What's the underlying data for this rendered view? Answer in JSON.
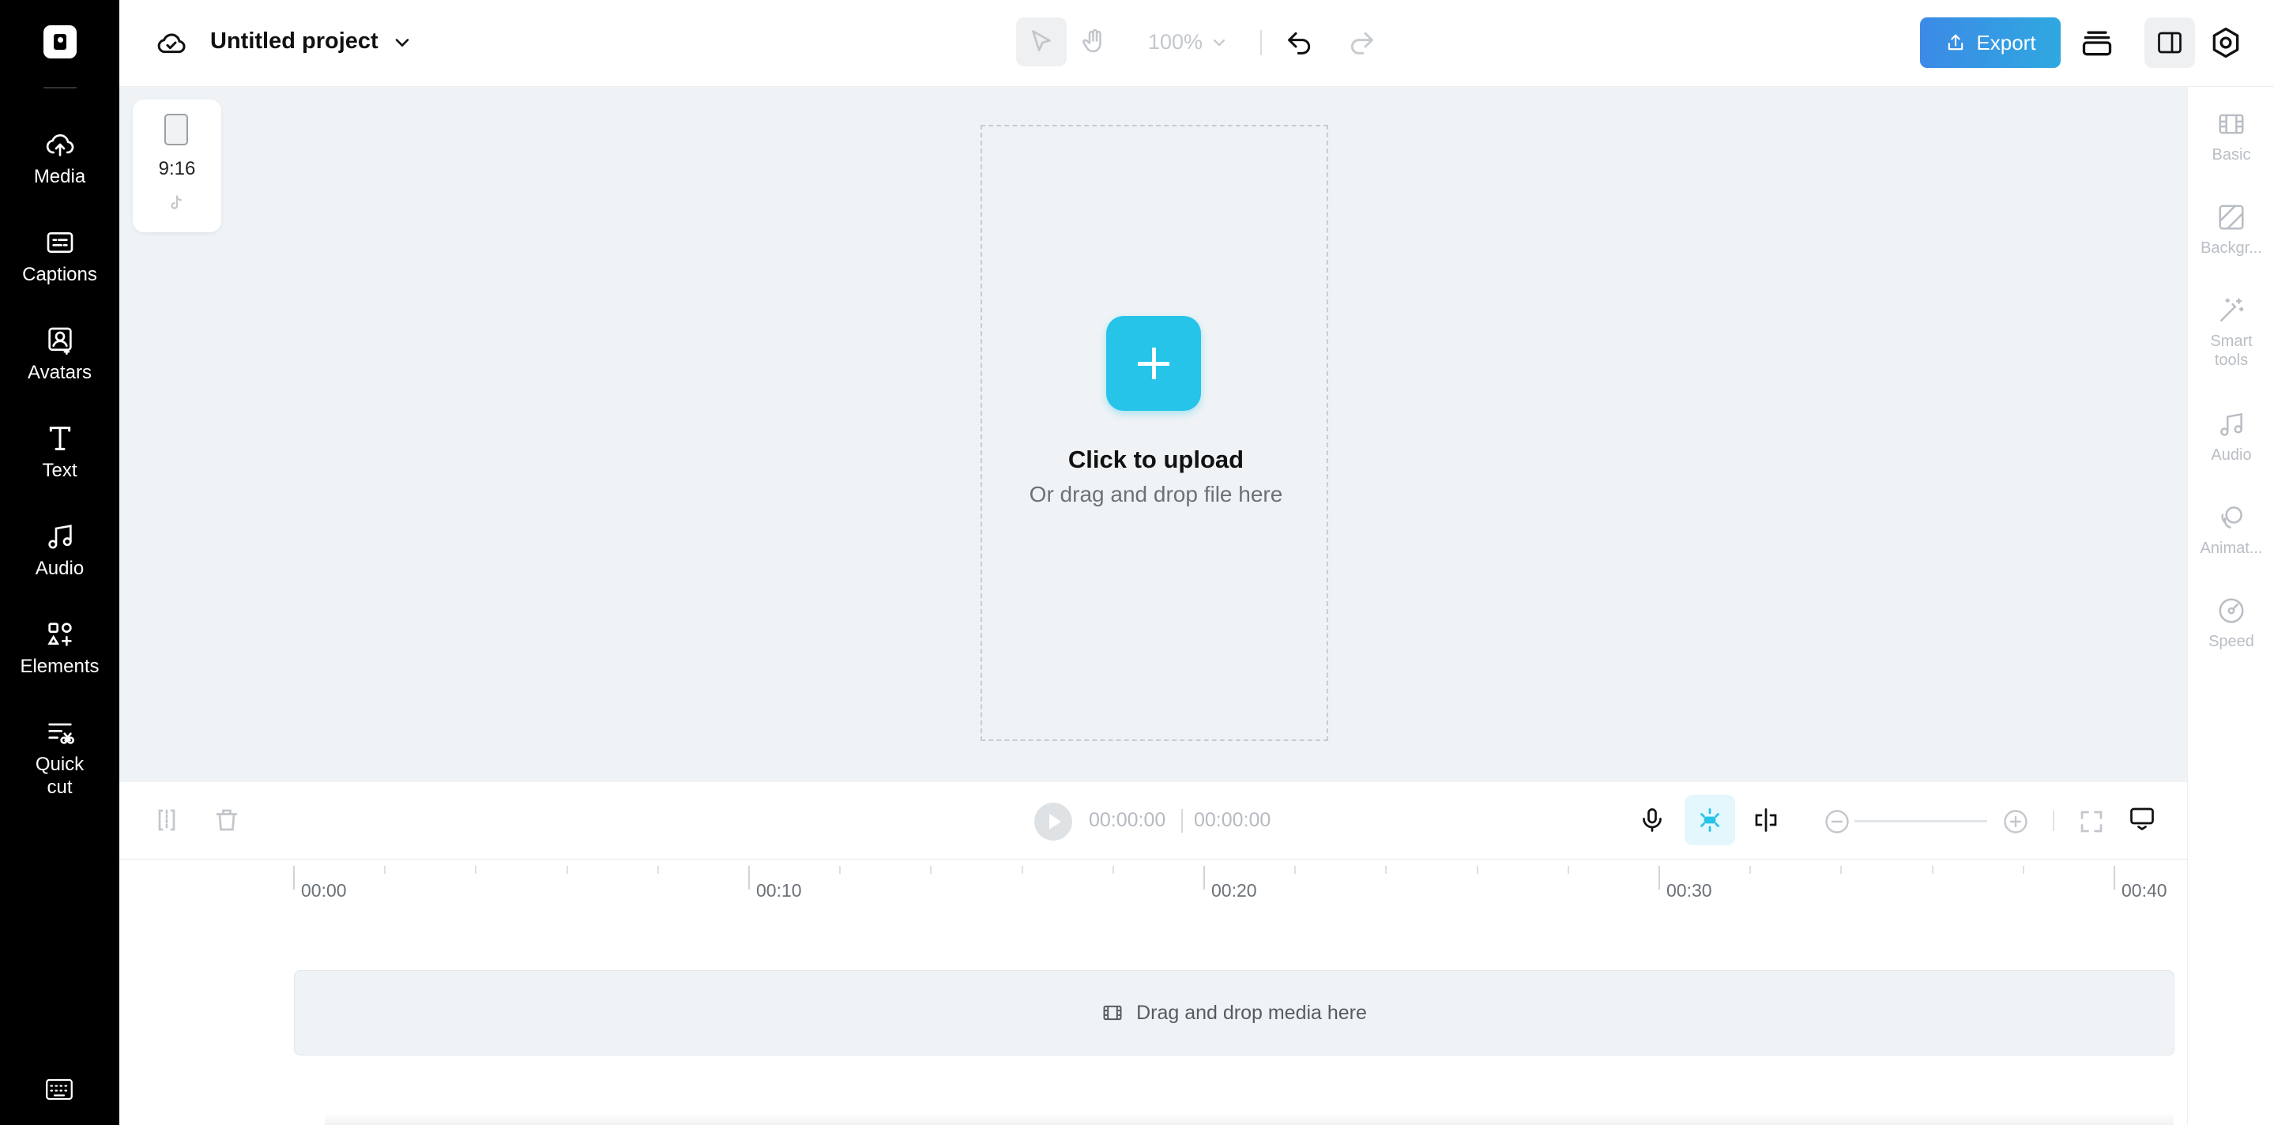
{
  "sidebar": {
    "items": [
      {
        "label": "Media",
        "icon": "cloud-upload-icon"
      },
      {
        "label": "Captions",
        "icon": "captions-icon"
      },
      {
        "label": "Avatars",
        "icon": "avatar-icon"
      },
      {
        "label": "Text",
        "icon": "text-icon"
      },
      {
        "label": "Audio",
        "icon": "music-note-icon"
      },
      {
        "label": "Elements",
        "icon": "elements-icon"
      },
      {
        "label": "Quick\ncut",
        "icon": "quick-cut-icon"
      }
    ]
  },
  "header": {
    "project_title": "Untitled project",
    "zoom": "100%",
    "export_label": "Export"
  },
  "canvas": {
    "aspect_ratio": "9:16",
    "upload_title": "Click to upload",
    "upload_subtitle": "Or drag and drop file here"
  },
  "right_panel": {
    "items": [
      {
        "label": "Basic",
        "icon": "basic-icon"
      },
      {
        "label": "Backgr...",
        "icon": "background-icon"
      },
      {
        "label": "Smart\ntools",
        "icon": "magic-wand-icon"
      },
      {
        "label": "Audio",
        "icon": "music-note-icon"
      },
      {
        "label": "Animat...",
        "icon": "animation-icon"
      },
      {
        "label": "Speed",
        "icon": "speed-icon"
      }
    ]
  },
  "timeline": {
    "current_time": "00:00:00",
    "total_time": "00:00:00",
    "ruler_labels": [
      "00:00",
      "00:10",
      "00:20",
      "00:30",
      "00:40"
    ],
    "drop_text": "Drag and drop media here"
  },
  "colors": {
    "accent": "#26c4e8",
    "export_start": "#3c8ae6",
    "export_end": "#2fa8e0",
    "sidebar_bg": "#000000",
    "canvas_bg": "#eff3f6"
  }
}
